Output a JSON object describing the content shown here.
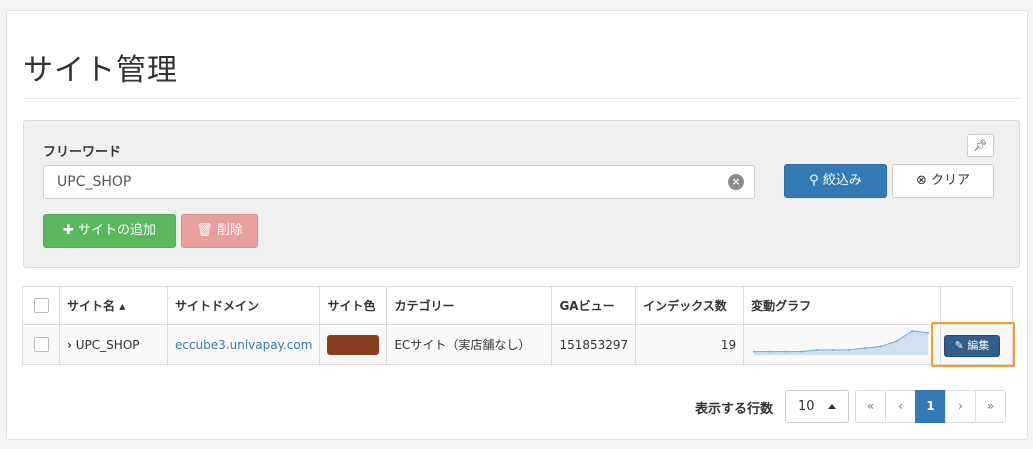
{
  "page_title": "サイト管理",
  "search": {
    "label": "フリーワード",
    "value": "UPC_SHOP",
    "pin_icon": "pushpin-icon",
    "filter_label": "絞込み",
    "clear_label": "クリア",
    "add_label": "サイトの追加",
    "delete_label": "削除"
  },
  "table": {
    "headers": [
      "サイト名",
      "サイトドメイン",
      "サイト色",
      "カテゴリー",
      "GAビュー",
      "インデックス数",
      "変動グラフ"
    ],
    "rows": [
      {
        "name": "UPC_SHOP",
        "domain": "eccube3.univapay.com",
        "color": "#8b3f22",
        "category": "ECサイト（実店舗なし）",
        "ga_view": "151853297",
        "index_count": "19",
        "sparkline": [
          2,
          2,
          2,
          2,
          3,
          3,
          3,
          4,
          5,
          8,
          14,
          13
        ],
        "edit_label": "編集"
      }
    ]
  },
  "pagination": {
    "rows_label": "表示する行数",
    "rows_value": "10",
    "first": "«",
    "prev": "‹",
    "current": "1",
    "next": "›",
    "last": "»"
  },
  "colors": {
    "primary": "#337ab7",
    "success": "#5cb85c",
    "danger_light": "#e89f9d",
    "highlight": "#f0a030"
  }
}
